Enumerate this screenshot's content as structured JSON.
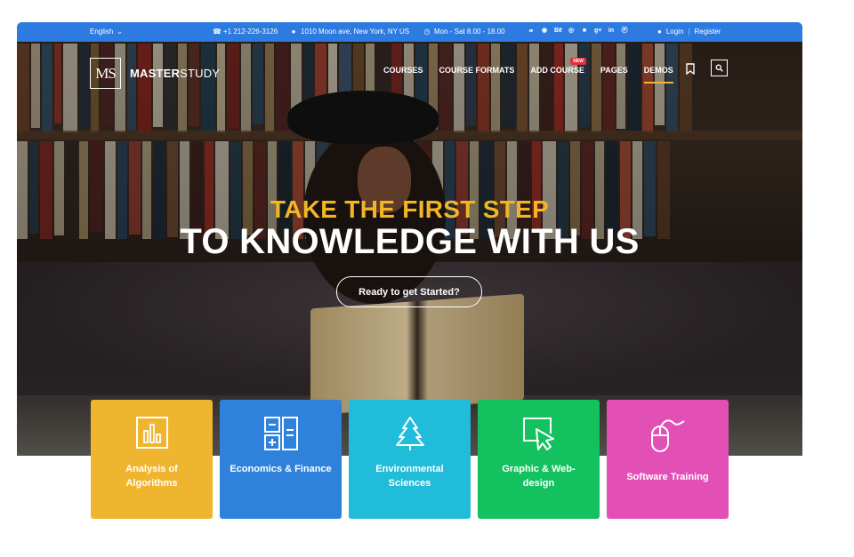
{
  "topbar": {
    "language": "English",
    "phone": "+1 212-226-3126",
    "address": "1010 Moon ave, New York, NY US",
    "hours": "Mon - Sat 8.00 - 18.00",
    "social_icons": [
      "twitter-icon",
      "instagram-icon",
      "behance-icon",
      "dribbble-icon",
      "flickr-icon",
      "google-plus-icon",
      "linkedin-icon",
      "pinterest-icon"
    ],
    "login": "Login",
    "register": "Register",
    "color": "#2d7be0"
  },
  "brand": {
    "logo_letters": "MS",
    "name_bold": "MASTER",
    "name_light": "STUDY"
  },
  "nav": {
    "items": [
      "COURSES",
      "COURSE FORMATS",
      "ADD COURSE",
      "PAGES",
      "DEMOS"
    ],
    "new_badge": "NEW",
    "active": "DEMOS",
    "accent": "#f0b733"
  },
  "hero": {
    "line1": "TAKE THE FIRST STEP",
    "line2": "TO KNOWLEDGE WITH US",
    "cta": "Ready to get Started?",
    "line1_color": "#f2b524"
  },
  "categories": [
    {
      "label": "Analysis of Algorithms",
      "icon": "chart-icon",
      "color": "#efb52e"
    },
    {
      "label": "Economics & Finance",
      "icon": "calculator-icon",
      "color": "#2f82dc"
    },
    {
      "label": "Environmental Sciences",
      "icon": "tree-icon",
      "color": "#21bcd9"
    },
    {
      "label": "Graphic & Web-design",
      "icon": "cursor-icon",
      "color": "#13c15f"
    },
    {
      "label": "Software Training",
      "icon": "mouse-icon",
      "color": "#e24fb5"
    }
  ]
}
